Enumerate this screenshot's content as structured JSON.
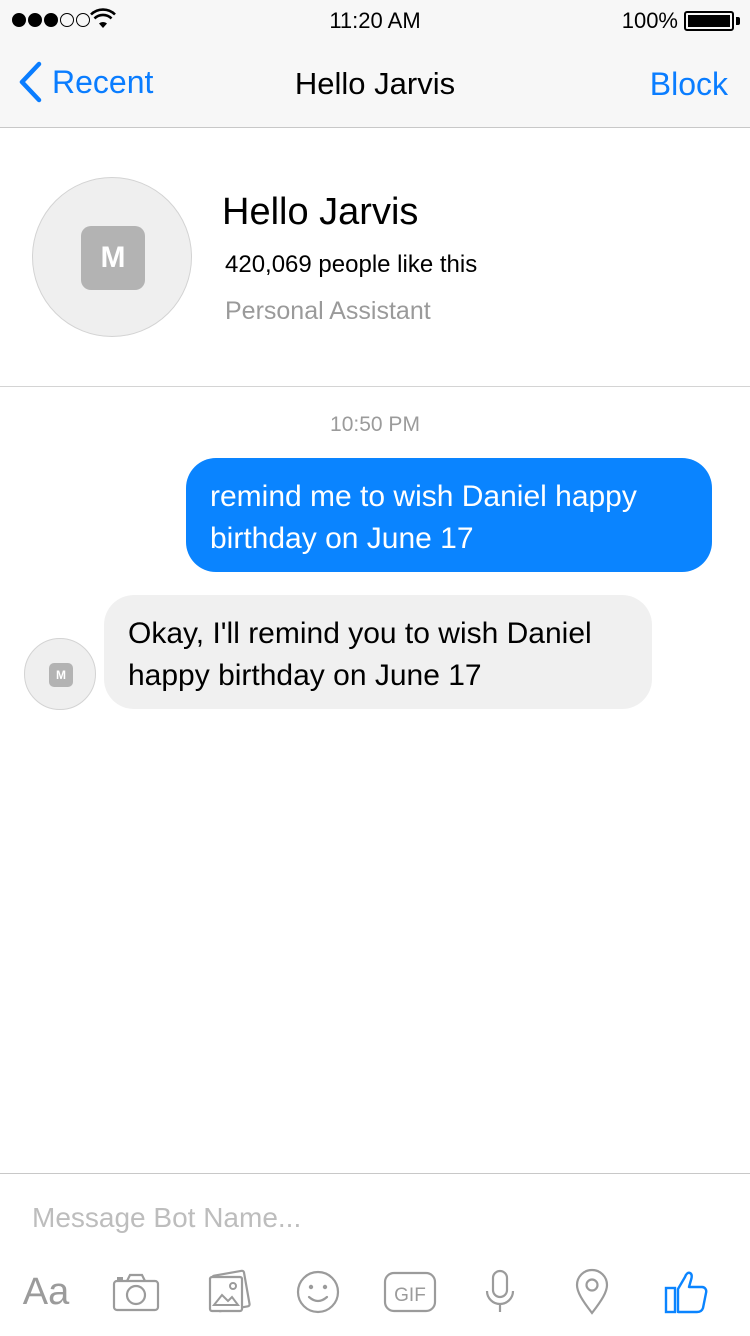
{
  "status_bar": {
    "time": "11:20 AM",
    "battery": "100%"
  },
  "nav": {
    "back_label": "Recent",
    "title": "Hello Jarvis",
    "action_label": "Block"
  },
  "profile": {
    "avatar_letter": "M",
    "name": "Hello Jarvis",
    "likes": "420,069 people like this",
    "subtitle": "Personal Assistant"
  },
  "conversation": {
    "timestamp": "10:50 PM",
    "messages": [
      {
        "from": "me",
        "text": "remind me to wish Daniel happy birthday on June 17"
      },
      {
        "from": "bot",
        "avatar_letter": "M",
        "text": "Okay, I'll remind you to wish Daniel happy birthday on June 17"
      }
    ]
  },
  "composer": {
    "placeholder": "Message Bot Name...",
    "tools": [
      {
        "icon": "text-format-icon",
        "label": "Aa"
      },
      {
        "icon": "camera-icon"
      },
      {
        "icon": "photos-icon"
      },
      {
        "icon": "emoji-icon"
      },
      {
        "icon": "gif-icon",
        "label": "GIF"
      },
      {
        "icon": "microphone-icon"
      },
      {
        "icon": "location-icon"
      },
      {
        "icon": "thumbs-up-icon"
      }
    ]
  },
  "colors": {
    "accent": "#0a84ff",
    "outgoing_bubble": "#0a84ff",
    "incoming_bubble": "#f0f0f0",
    "secondary_text": "#9b9b9b"
  }
}
